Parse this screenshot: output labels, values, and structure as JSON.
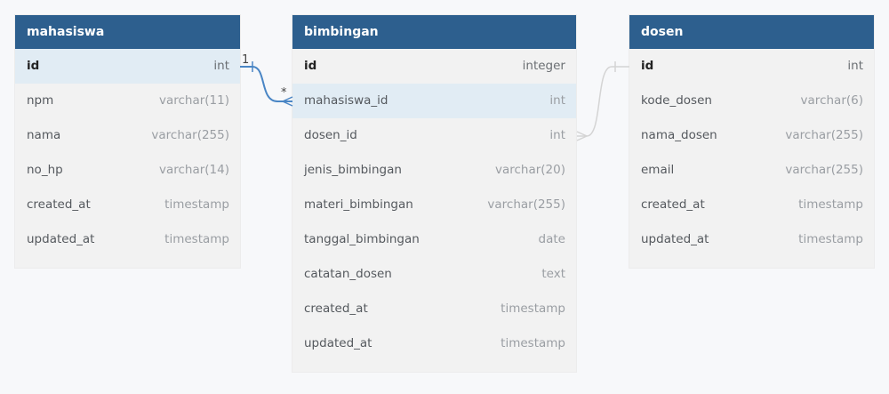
{
  "diagram": {
    "tables": [
      {
        "name": "mahasiswa",
        "columns": [
          {
            "name": "id",
            "type": "int",
            "pk": true
          },
          {
            "name": "npm",
            "type": "varchar(11)"
          },
          {
            "name": "nama",
            "type": "varchar(255)"
          },
          {
            "name": "no_hp",
            "type": "varchar(14)"
          },
          {
            "name": "created_at",
            "type": "timestamp"
          },
          {
            "name": "updated_at",
            "type": "timestamp"
          }
        ]
      },
      {
        "name": "bimbingan",
        "columns": [
          {
            "name": "id",
            "type": "integer",
            "pk": true
          },
          {
            "name": "mahasiswa_id",
            "type": "int"
          },
          {
            "name": "dosen_id",
            "type": "int"
          },
          {
            "name": "jenis_bimbingan",
            "type": "varchar(20)"
          },
          {
            "name": "materi_bimbingan",
            "type": "varchar(255)"
          },
          {
            "name": "tanggal_bimbingan",
            "type": "date"
          },
          {
            "name": "catatan_dosen",
            "type": "text"
          },
          {
            "name": "created_at",
            "type": "timestamp"
          },
          {
            "name": "updated_at",
            "type": "timestamp"
          }
        ]
      },
      {
        "name": "dosen",
        "columns": [
          {
            "name": "id",
            "type": "int",
            "pk": true
          },
          {
            "name": "kode_dosen",
            "type": "varchar(6)"
          },
          {
            "name": "nama_dosen",
            "type": "varchar(255)"
          },
          {
            "name": "email",
            "type": "varchar(255)"
          },
          {
            "name": "created_at",
            "type": "timestamp"
          },
          {
            "name": "updated_at",
            "type": "timestamp"
          }
        ]
      }
    ],
    "relations": [
      {
        "from": "mahasiswa.id",
        "to": "bimbingan.mahasiswa_id",
        "from_label": "1",
        "to_label": "*",
        "highlighted": true,
        "color": "#4a86c5"
      },
      {
        "from": "dosen.id",
        "to": "bimbingan.dosen_id",
        "highlighted": false,
        "color": "#d4d4d4"
      }
    ],
    "colors": {
      "header": "#2d5f8e",
      "highlight_row": "#e1ecf4",
      "table_bg": "#f2f2f2"
    }
  }
}
